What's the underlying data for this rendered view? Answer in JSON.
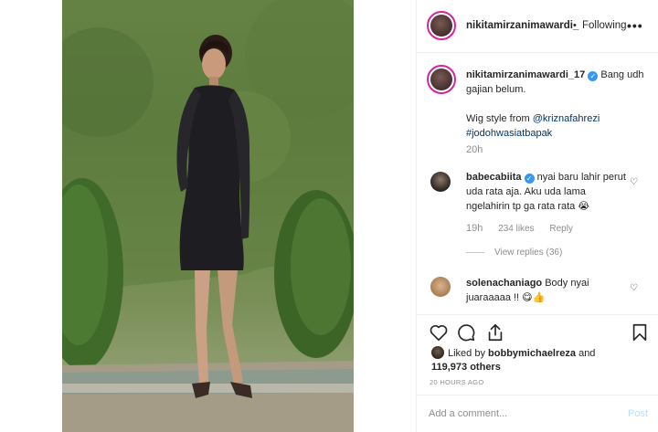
{
  "post": {
    "author": "nikitamirzanimawardi_",
    "follow_separator": "•",
    "follow_status": "Following",
    "more_label": "•••"
  },
  "caption": {
    "username": "nikitamirzanimawardi_17",
    "text": "Bang udh gajian belum.",
    "line2_prefix": "Wig style from ",
    "mention": "@kriznafahrezi",
    "hashtag": "#jodohwasiatbapak",
    "time": "20h"
  },
  "comments": [
    {
      "username": "babecabiita",
      "text": "nyai baru lahir perut uda rata aja. Aku uda lama ngelahirin tp ga rata rata 😭",
      "time": "19h",
      "likes": "234 likes",
      "reply_label": "Reply",
      "view_replies": "View replies (36)"
    },
    {
      "username": "solenachaniago",
      "text": "Body nyai juaraaaaa !! 😋👍"
    }
  ],
  "likes": {
    "prefix": "Liked by ",
    "user": "bobbymichaelreza",
    "and": " and",
    "others": "119,973 others"
  },
  "timestamp": "20 HOURS AGO",
  "add_comment": {
    "placeholder": "Add a comment...",
    "post_label": "Post"
  },
  "icons": {
    "heart": "heart-icon",
    "comment": "comment-icon",
    "share": "share-icon",
    "save": "bookmark-icon",
    "verified": "verified-icon"
  },
  "colors": {
    "verified": "#3897f0",
    "link": "#003569",
    "muted": "#8e8e8e",
    "post_disabled": "#b2dffc"
  }
}
